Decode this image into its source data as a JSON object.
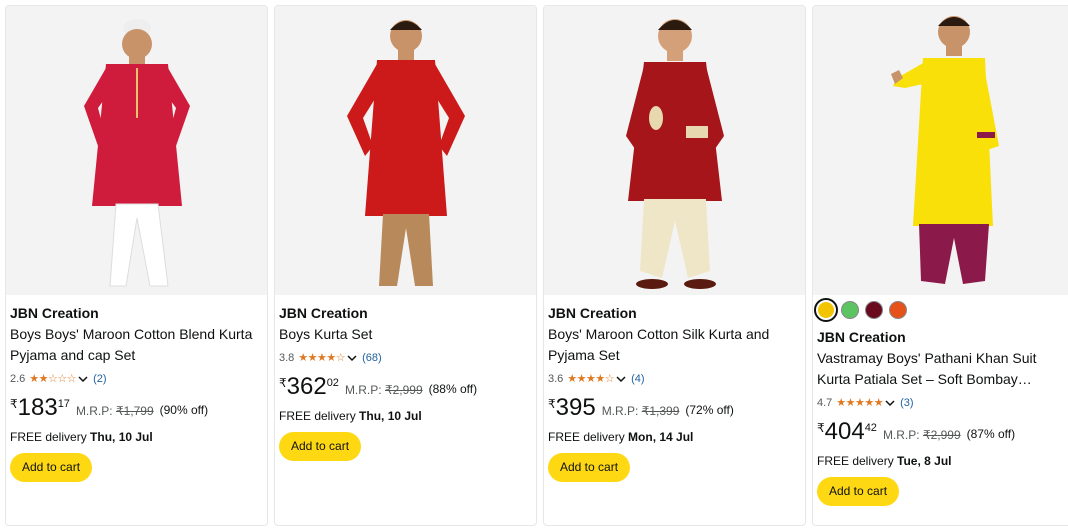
{
  "products": [
    {
      "brand": "JBN Creation",
      "title_line1": "Boys Boys' Maroon Cotton Blend Kurta",
      "title_line2": "Pyjama and cap Set",
      "rating": "2.6",
      "stars": "★★☆☆☆",
      "review_count": "(2)",
      "currency": "₹",
      "price_whole": "183",
      "price_fraction": "17",
      "mrp_label": "M.R.P:",
      "mrp_value": "₹1,799",
      "discount": "(90% off)",
      "delivery_label": "FREE delivery",
      "delivery_date": "Thu, 10 Jul",
      "button": "Add to cart",
      "colors": {
        "kurta": "#d01c3c",
        "pyjama": "#ffffff",
        "cap": "#eeeeee"
      }
    },
    {
      "brand": "JBN Creation",
      "title_line1": "Boys Kurta Set",
      "title_line2": "",
      "rating": "3.8",
      "stars": "★★★★☆",
      "review_count": "(68)",
      "currency": "₹",
      "price_whole": "362",
      "price_fraction": "02",
      "mrp_label": "M.R.P:",
      "mrp_value": "₹2,999",
      "discount": "(88% off)",
      "delivery_label": "FREE delivery",
      "delivery_date": "Thu, 10 Jul",
      "button": "Add to cart",
      "colors": {
        "kurta": "#cc1a1a",
        "pyjama": "#b8895a"
      }
    },
    {
      "brand": "JBN Creation",
      "title_line1": "Boys' Maroon Cotton Silk Kurta and",
      "title_line2": "Pyjama Set",
      "rating": "3.6",
      "stars": "★★★★☆",
      "review_count": "(4)",
      "currency": "₹",
      "price_whole": "395",
      "price_fraction": "",
      "mrp_label": "M.R.P:",
      "mrp_value": "₹1,399",
      "discount": "(72% off)",
      "delivery_label": "FREE delivery",
      "delivery_date": "Mon, 14 Jul",
      "button": "Add to cart",
      "colors": {
        "kurta": "#a5151a",
        "pyjama": "#efe6c8"
      }
    },
    {
      "brand": "JBN Creation",
      "title_line1": "Vastramay Boys' Pathani Khan Suit",
      "title_line2": "Kurta Patiala Set – Soft Bombay…",
      "rating": "4.7",
      "stars": "★★★★★",
      "review_count": "(3)",
      "currency": "₹",
      "price_whole": "404",
      "price_fraction": "42",
      "mrp_label": "M.R.P:",
      "mrp_value": "₹2,999",
      "discount": "(87% off)",
      "delivery_label": "FREE delivery",
      "delivery_date": "Tue, 8 Jul",
      "button": "Add to cart",
      "swatches": [
        "#f3c400",
        "#5cc460",
        "#6a0a1e",
        "#e5531a"
      ],
      "colors": {
        "kurta": "#f9e008",
        "pyjama": "#8b1a4a"
      }
    }
  ]
}
